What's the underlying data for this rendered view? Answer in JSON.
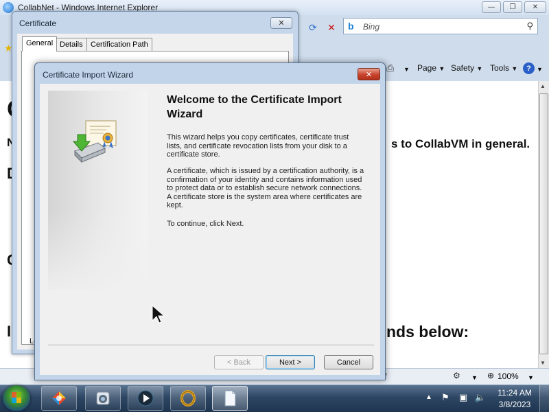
{
  "ie": {
    "title": "CollabNet - Windows Internet Explorer",
    "search_placeholder": "Bing",
    "command_bar": {
      "page": "Page",
      "safety": "Safety",
      "tools": "Tools"
    },
    "page_text_1": "s to CollabVM in general.",
    "page_text_2": "nds below:",
    "page_fragments": [
      "C",
      "N",
      "D",
      "C",
      "I"
    ],
    "status_fragment": "f",
    "zoom": "100%"
  },
  "certificate_window": {
    "title": "Certificate",
    "tabs": [
      "General",
      "Details",
      "Certification Path"
    ],
    "fragment": "Le"
  },
  "wizard": {
    "title": "Certificate Import Wizard",
    "heading": "Welcome to the Certificate Import Wizard",
    "paragraph1": "This wizard helps you copy certificates, certificate trust lists, and certificate revocation lists from your disk to a certificate store.",
    "paragraph2": "A certificate, which is issued by a certification authority, is a confirmation of your identity and contains information used to protect data or to establish secure network connections. A certificate store is the system area where certificates are kept.",
    "paragraph3": "To continue, click Next.",
    "buttons": {
      "back": "< Back",
      "next": "Next >",
      "cancel": "Cancel"
    }
  },
  "taskbar": {
    "time": "11:24 AM",
    "date": "3/8/2023"
  }
}
